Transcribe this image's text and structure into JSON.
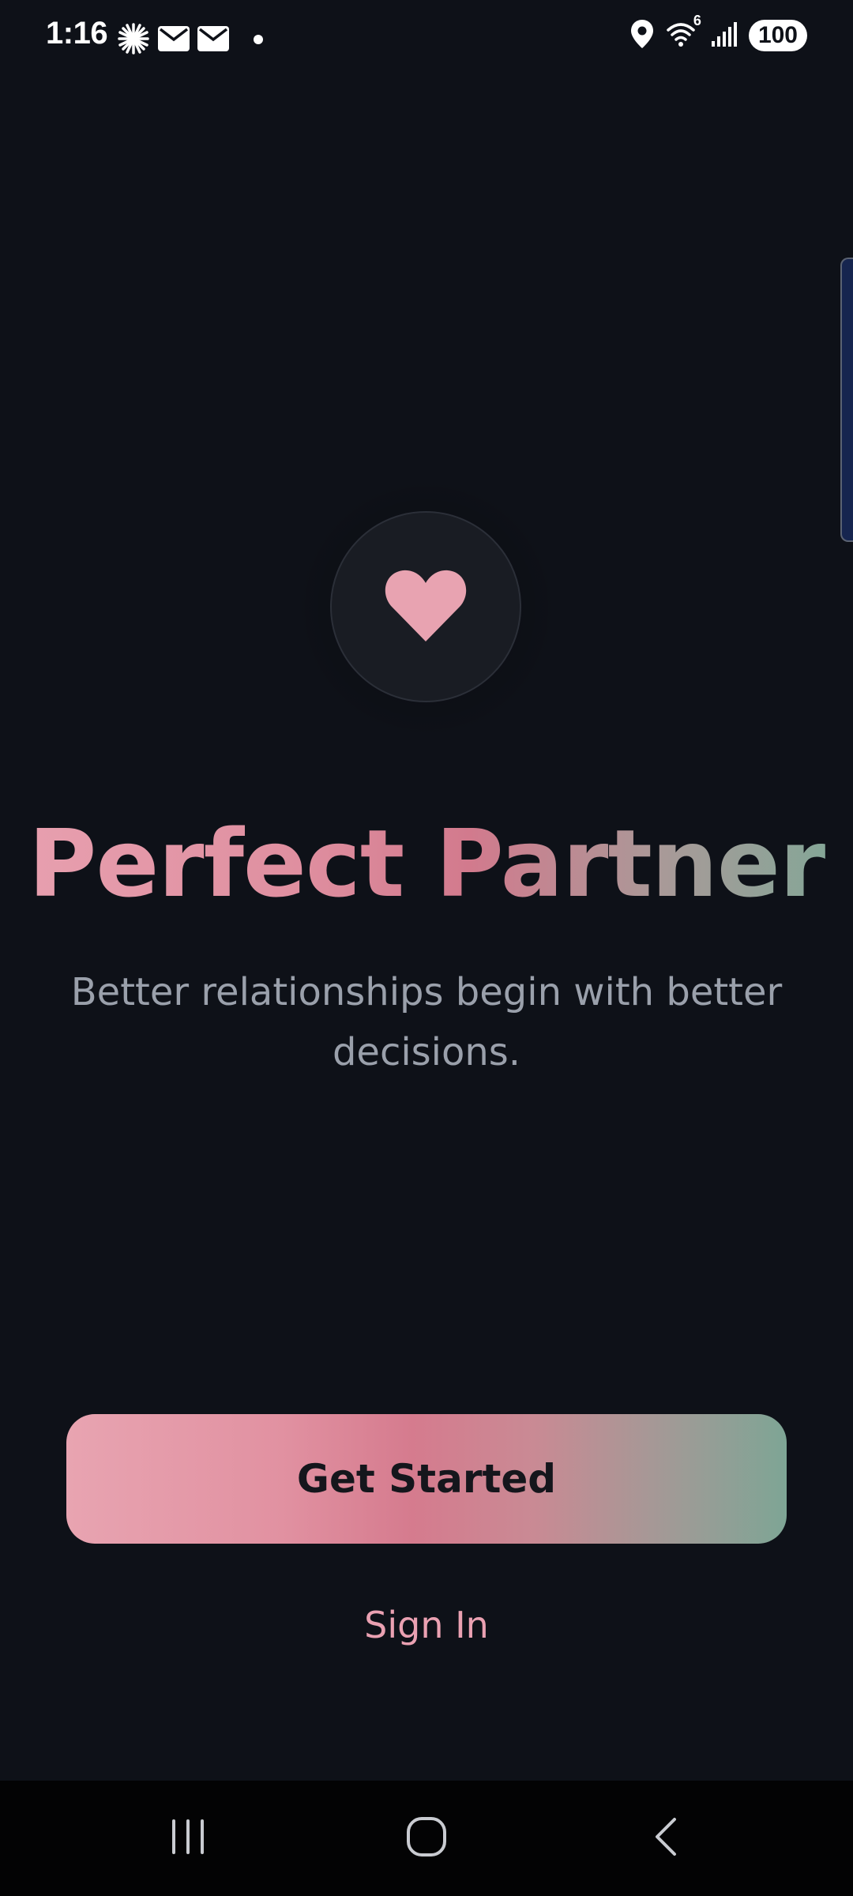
{
  "status_bar": {
    "time": "1:16",
    "notification_icons": [
      "asterisk-icon",
      "mail-icon",
      "mail-icon",
      "dot-icon"
    ],
    "system_icons": [
      "location-icon",
      "wifi-icon",
      "signal-icon"
    ],
    "wifi_badge": "6",
    "battery": "100"
  },
  "logo": {
    "icon": "heart-icon",
    "color": "#e8a3b1"
  },
  "welcome": {
    "title": "Perfect Partner",
    "tagline": "Better relationships begin with better decisions."
  },
  "actions": {
    "get_started_label": "Get Started",
    "sign_in_label": "Sign In"
  },
  "nav_bar": {
    "buttons": [
      "recents-icon",
      "home-icon",
      "back-icon"
    ]
  },
  "colors": {
    "background": "#0e1118",
    "accent_pink": "#e8a1b0",
    "accent_rose": "#d27a8d",
    "accent_green": "#7fa897",
    "tagline": "#9aa0ab"
  }
}
